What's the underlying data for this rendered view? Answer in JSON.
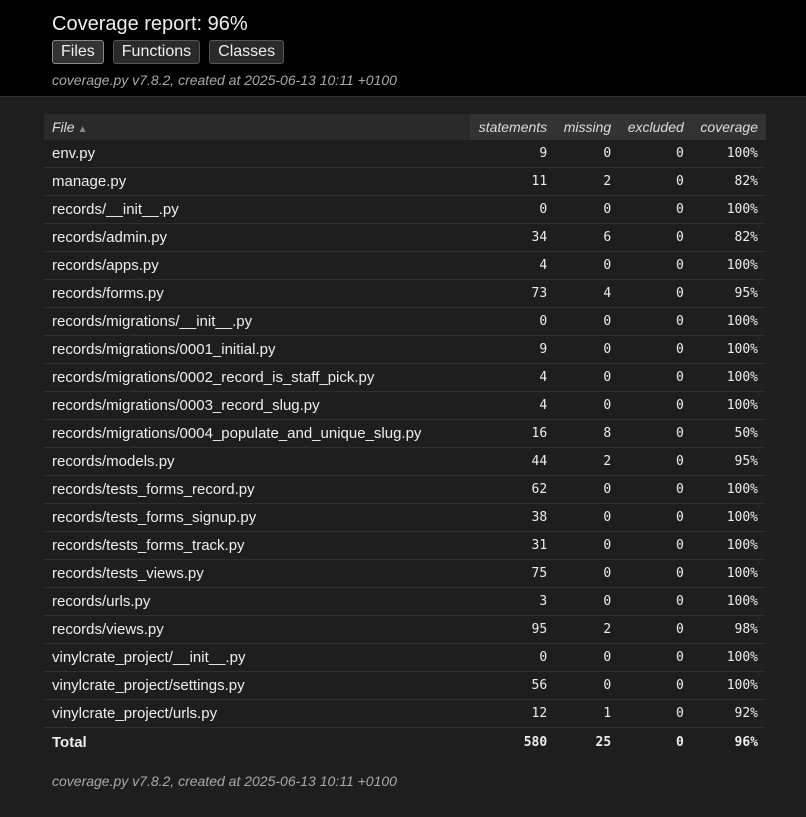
{
  "header": {
    "title": "Coverage report: 96%",
    "tabs": [
      {
        "label": "Files"
      },
      {
        "label": "Functions"
      },
      {
        "label": "Classes"
      }
    ],
    "meta": "coverage.py v7.8.2, created at 2025-06-13 10:11 +0100"
  },
  "table": {
    "columns": {
      "file": "File",
      "statements": "statements",
      "missing": "missing",
      "excluded": "excluded",
      "coverage": "coverage"
    },
    "sort_indicator": "▲",
    "rows": [
      {
        "file": "env.py",
        "statements": "9",
        "missing": "0",
        "excluded": "0",
        "coverage": "100%"
      },
      {
        "file": "manage.py",
        "statements": "11",
        "missing": "2",
        "excluded": "0",
        "coverage": "82%"
      },
      {
        "file": "records/__init__.py",
        "statements": "0",
        "missing": "0",
        "excluded": "0",
        "coverage": "100%"
      },
      {
        "file": "records/admin.py",
        "statements": "34",
        "missing": "6",
        "excluded": "0",
        "coverage": "82%"
      },
      {
        "file": "records/apps.py",
        "statements": "4",
        "missing": "0",
        "excluded": "0",
        "coverage": "100%"
      },
      {
        "file": "records/forms.py",
        "statements": "73",
        "missing": "4",
        "excluded": "0",
        "coverage": "95%"
      },
      {
        "file": "records/migrations/__init__.py",
        "statements": "0",
        "missing": "0",
        "excluded": "0",
        "coverage": "100%"
      },
      {
        "file": "records/migrations/0001_initial.py",
        "statements": "9",
        "missing": "0",
        "excluded": "0",
        "coverage": "100%"
      },
      {
        "file": "records/migrations/0002_record_is_staff_pick.py",
        "statements": "4",
        "missing": "0",
        "excluded": "0",
        "coverage": "100%"
      },
      {
        "file": "records/migrations/0003_record_slug.py",
        "statements": "4",
        "missing": "0",
        "excluded": "0",
        "coverage": "100%"
      },
      {
        "file": "records/migrations/0004_populate_and_unique_slug.py",
        "statements": "16",
        "missing": "8",
        "excluded": "0",
        "coverage": "50%"
      },
      {
        "file": "records/models.py",
        "statements": "44",
        "missing": "2",
        "excluded": "0",
        "coverage": "95%"
      },
      {
        "file": "records/tests_forms_record.py",
        "statements": "62",
        "missing": "0",
        "excluded": "0",
        "coverage": "100%"
      },
      {
        "file": "records/tests_forms_signup.py",
        "statements": "38",
        "missing": "0",
        "excluded": "0",
        "coverage": "100%"
      },
      {
        "file": "records/tests_forms_track.py",
        "statements": "31",
        "missing": "0",
        "excluded": "0",
        "coverage": "100%"
      },
      {
        "file": "records/tests_views.py",
        "statements": "75",
        "missing": "0",
        "excluded": "0",
        "coverage": "100%"
      },
      {
        "file": "records/urls.py",
        "statements": "3",
        "missing": "0",
        "excluded": "0",
        "coverage": "100%"
      },
      {
        "file": "records/views.py",
        "statements": "95",
        "missing": "2",
        "excluded": "0",
        "coverage": "98%"
      },
      {
        "file": "vinylcrate_project/__init__.py",
        "statements": "0",
        "missing": "0",
        "excluded": "0",
        "coverage": "100%"
      },
      {
        "file": "vinylcrate_project/settings.py",
        "statements": "56",
        "missing": "0",
        "excluded": "0",
        "coverage": "100%"
      },
      {
        "file": "vinylcrate_project/urls.py",
        "statements": "12",
        "missing": "1",
        "excluded": "0",
        "coverage": "92%"
      }
    ],
    "total": {
      "file": "Total",
      "statements": "580",
      "missing": "25",
      "excluded": "0",
      "coverage": "96%"
    }
  },
  "footer": {
    "meta": "coverage.py v7.8.2, created at 2025-06-13 10:11 +0100"
  }
}
